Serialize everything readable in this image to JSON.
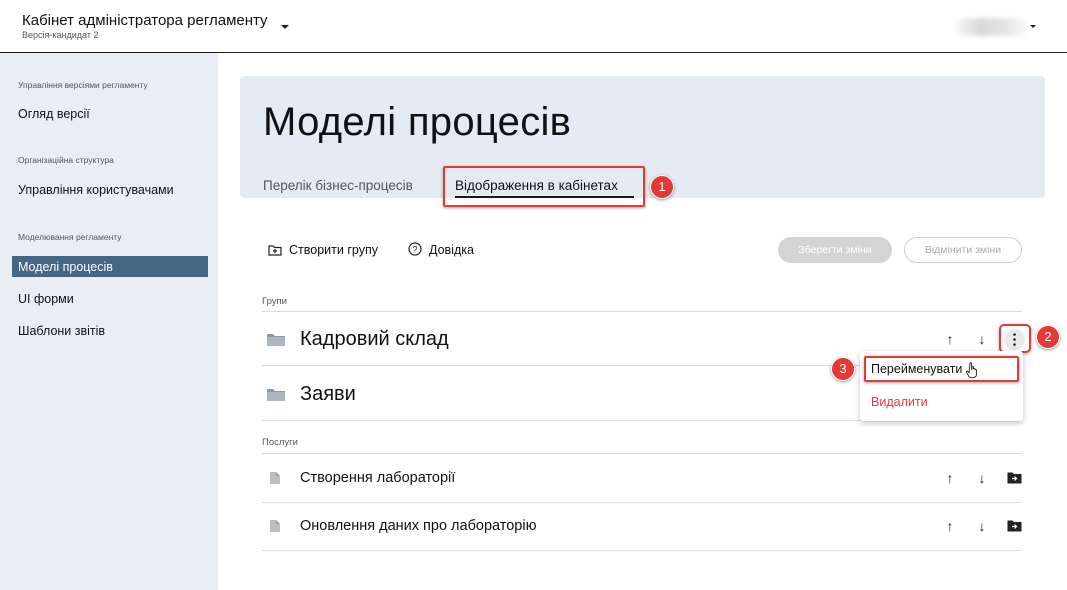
{
  "header": {
    "app_title": "Кабінет адміністратора регламенту",
    "version_label": "Версія-кандидат 2"
  },
  "sidebar": {
    "sections": [
      {
        "label": "Управління версіями регламенту",
        "items": [
          {
            "label": "Огляд версії"
          }
        ]
      },
      {
        "label": "Організаційна структура",
        "items": [
          {
            "label": "Управління користувачами"
          }
        ]
      },
      {
        "label": "Моделювання регламенту",
        "items": [
          {
            "label": "Моделі процесів",
            "active": true
          },
          {
            "label": "UI форми"
          },
          {
            "label": "Шаблони звітів"
          }
        ]
      }
    ]
  },
  "main": {
    "page_title": "Моделі процесів",
    "tabs": [
      {
        "label": "Перелік бізнес-процесів",
        "active": false
      },
      {
        "label": "Відображення в кабінетах",
        "active": true
      }
    ],
    "toolbar": {
      "create_group": "Створити групу",
      "help": "Довідка",
      "save": "Зберегти зміни",
      "cancel": "Відмінити зміни"
    },
    "groups_label": "Групи",
    "groups": [
      {
        "name": "Кадровий склад",
        "icon": "folder-icon"
      },
      {
        "name": "Заяви",
        "icon": "folder-icon"
      }
    ],
    "services_label": "Послуги",
    "services": [
      {
        "name": "Створення лабораторії",
        "icon": "file-icon"
      },
      {
        "name": "Оновлення даних про лабораторію",
        "icon": "file-icon"
      }
    ],
    "context_menu": {
      "rename": "Перейменувати",
      "delete": "Видалити"
    }
  },
  "annotations": {
    "badges": [
      "1",
      "2",
      "3"
    ],
    "color": "#e53935"
  },
  "colors": {
    "sidebar_bg": "#e8eef4",
    "sidebar_active": "#456783",
    "hero_bg": "#e5ebf2",
    "danger": "#e53935"
  }
}
